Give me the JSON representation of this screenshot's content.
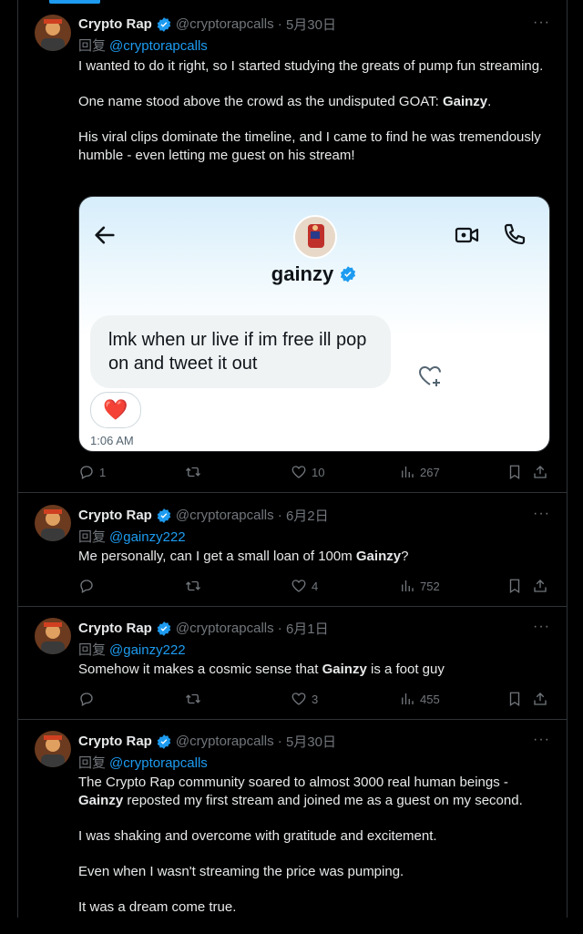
{
  "author": {
    "name": "Crypto Rap",
    "handle": "@cryptorapcalls"
  },
  "reply_prefix": "回复",
  "tweets": [
    {
      "date": "5月30日",
      "reply_to": "@cryptorapcalls",
      "paragraphs": [
        {
          "parts": [
            "I wanted to do it right, so I started studying the greats of pump fun streaming."
          ]
        },
        {
          "parts": [
            "One name stood above the crowd as the undisputed GOAT: ",
            "Gainzy",
            "."
          ]
        },
        {
          "parts": [
            "His viral clips dominate the timeline, and I came to find he was tremendously humble - even letting me guest on his stream!"
          ]
        }
      ],
      "stats": {
        "replies": "1",
        "reposts": "",
        "likes": "10",
        "views": "267"
      }
    },
    {
      "date": "6月2日",
      "reply_to": "@gainzy222",
      "paragraphs": [
        {
          "parts": [
            "Me personally, can I get a small loan of 100m ",
            "Gainzy",
            "?"
          ]
        }
      ],
      "stats": {
        "replies": "",
        "reposts": "",
        "likes": "4",
        "views": "752"
      }
    },
    {
      "date": "6月1日",
      "reply_to": "@gainzy222",
      "paragraphs": [
        {
          "parts": [
            "Somehow it makes a cosmic sense that ",
            "Gainzy",
            " is a foot guy"
          ]
        }
      ],
      "stats": {
        "replies": "",
        "reposts": "",
        "likes": "3",
        "views": "455"
      }
    },
    {
      "date": "5月30日",
      "reply_to": "@cryptorapcalls",
      "paragraphs": [
        {
          "parts": [
            "The Crypto Rap community soared to almost 3000 real human beings - ",
            "Gainzy",
            " reposted my first stream and joined me as a guest on my second."
          ]
        },
        {
          "parts": [
            "I was shaking and overcome with gratitude and excitement."
          ]
        },
        {
          "parts": [
            "Even when I wasn't streaming the price was pumping."
          ]
        },
        {
          "parts": [
            "It was a dream come true."
          ]
        }
      ]
    }
  ],
  "dm_card": {
    "contact_name": "gainzy",
    "message": "lmk when ur live if im free ill pop on and tweet it out",
    "reaction": "❤️",
    "time": "1:06 AM"
  },
  "more_label": "···",
  "colors": {
    "accent": "#1d9bf0",
    "background": "#000000",
    "muted": "#71767b",
    "text": "#e7e9ea",
    "border": "#2f3336"
  }
}
